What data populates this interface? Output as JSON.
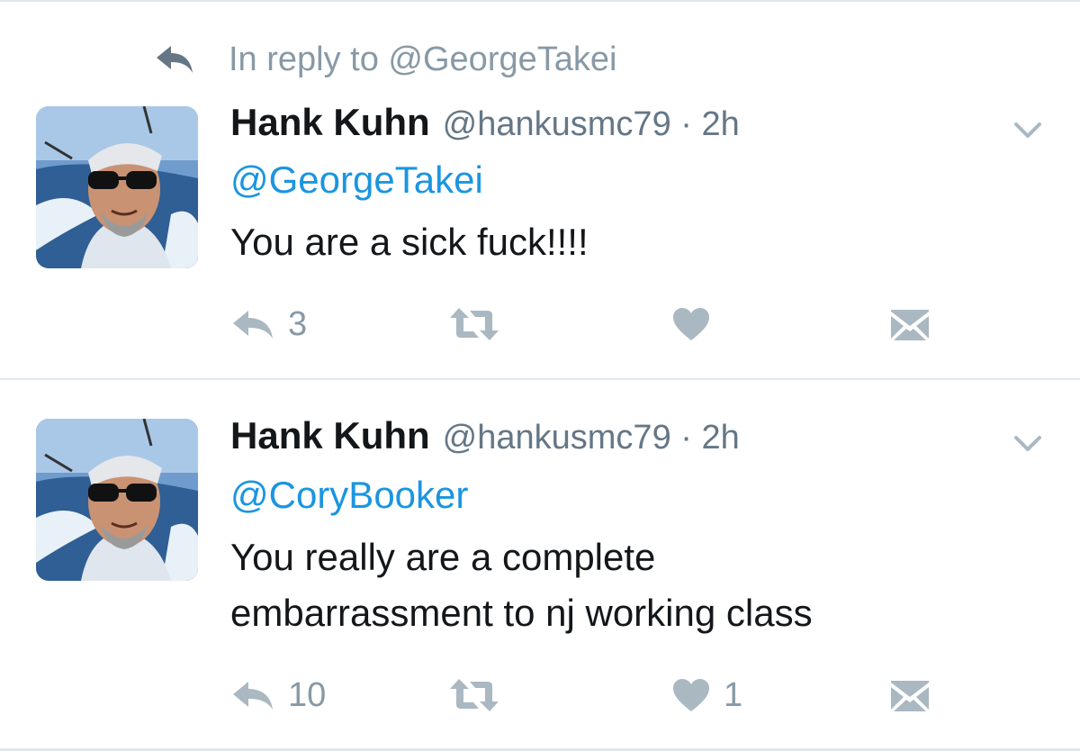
{
  "reply_context": {
    "text": "In reply to @GeorgeTakei"
  },
  "tweets": [
    {
      "display_name": "Hank Kuhn",
      "handle_time": "@hankusmc79 · 2h",
      "mention": "@GeorgeTakei",
      "lines": [
        "You are a sick fuck!!!!"
      ],
      "reply_count": "3",
      "retweet_count": "",
      "like_count": ""
    },
    {
      "display_name": "Hank Kuhn",
      "handle_time": "@hankusmc79 · 2h",
      "mention": "@CoryBooker",
      "lines": [
        "You really are a complete",
        "embarrassment to nj working class"
      ],
      "reply_count": "10",
      "retweet_count": "",
      "like_count": "1"
    }
  ],
  "icons": {
    "reply": "reply-arrow-icon",
    "retweet": "retweet-icon",
    "like": "heart-icon",
    "dm": "envelope-icon",
    "caret": "chevron-down-icon"
  },
  "colors": {
    "text_primary": "#14171a",
    "text_secondary": "#8899a6",
    "link": "#1b95e0",
    "divider": "#e1e8ed",
    "icon": "#aab8c2"
  }
}
